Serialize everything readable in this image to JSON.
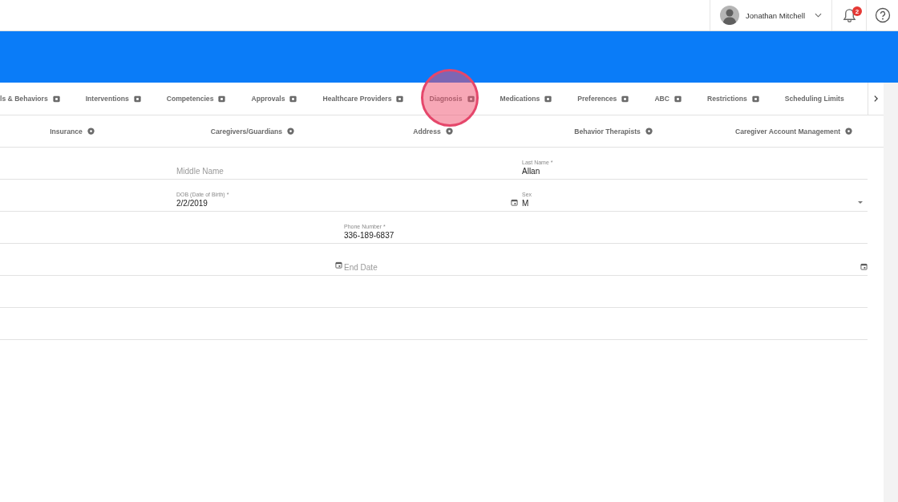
{
  "header": {
    "user_name": "Jonathan Mitchell",
    "notification_count": "2"
  },
  "tabs": [
    {
      "label": "ls & Behaviors"
    },
    {
      "label": "Interventions"
    },
    {
      "label": "Competencies"
    },
    {
      "label": "Approvals"
    },
    {
      "label": "Healthcare Providers"
    },
    {
      "label": "Diagnosis"
    },
    {
      "label": "Medications"
    },
    {
      "label": "Preferences"
    },
    {
      "label": "ABC"
    },
    {
      "label": "Restrictions"
    },
    {
      "label": "Scheduling Limits"
    }
  ],
  "subtabs": [
    {
      "label": "Insurance"
    },
    {
      "label": "Caregivers/Guardians"
    },
    {
      "label": "Address"
    },
    {
      "label": "Behavior Therapists"
    },
    {
      "label": "Caregiver Account Management"
    }
  ],
  "form_rows": [
    {
      "fields": [
        {
          "kind": "text",
          "placeholder": "Middle Name"
        },
        {
          "kind": "text",
          "label": "Last Name *",
          "value": "Allan"
        }
      ]
    },
    {
      "fields": [
        {
          "kind": "date",
          "label": "DOB (Date of Birth) *",
          "value": "2/2/2019"
        },
        {
          "kind": "select",
          "label": "Sex",
          "value": "M"
        }
      ]
    },
    {
      "fields": [
        {
          "kind": "text",
          "label": "Phone Number *",
          "value": "336-189-6837"
        }
      ]
    },
    {
      "fields": [
        {
          "kind": "date",
          "placeholder": "End Date"
        }
      ]
    },
    {
      "fields": []
    },
    {
      "fields": []
    }
  ]
}
